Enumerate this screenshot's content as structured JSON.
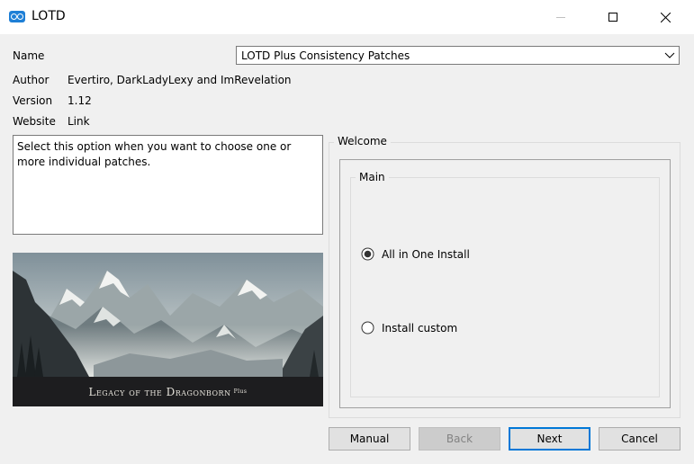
{
  "window": {
    "title": "LOTD"
  },
  "info": {
    "name_label": "Name",
    "name_value": "LOTD Plus Consistency Patches",
    "author_label": "Author",
    "author_value": "Evertiro, DarkLadyLexy and ImRevelation",
    "version_label": "Version",
    "version_value": "1.12",
    "website_label": "Website",
    "website_value": "Link"
  },
  "description": "Select this option when you want to choose one or more individual patches.",
  "banner": {
    "caption": "Legacy of the Dragonborn",
    "caption_super": "Plus"
  },
  "options": {
    "step_title": "Welcome",
    "group_title": "Main",
    "items": [
      {
        "label": "All in One Install",
        "selected": true
      },
      {
        "label": "Install custom",
        "selected": false
      }
    ]
  },
  "buttons": {
    "manual": "Manual",
    "back": "Back",
    "next": "Next",
    "cancel": "Cancel"
  },
  "colors": {
    "accent": "#0078d7",
    "window_bg": "#f0f0f0"
  }
}
